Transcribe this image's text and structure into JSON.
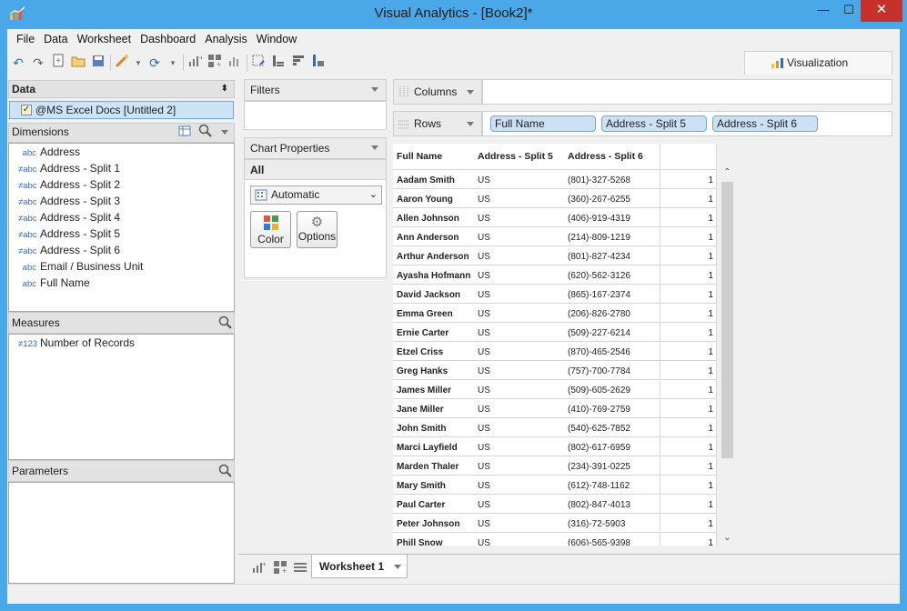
{
  "window": {
    "title": "Visual Analytics - [Book2]*",
    "min_glyph": "—",
    "max_glyph": "☐",
    "close_glyph": "✕"
  },
  "menu": [
    "File",
    "Data",
    "Worksheet",
    "Dashboard",
    "Analysis",
    "Window"
  ],
  "toolbar": {
    "icons": [
      "undo-icon",
      "redo-icon",
      "new-icon",
      "open-icon",
      "save-icon",
      "auto-update-icon",
      "refresh-icon",
      "new-worksheet-icon",
      "new-dashboard-icon",
      "show-me-icon",
      "clear-sheet-icon",
      "sort-ascending-icon",
      "sort-descending-icon",
      "fit-icon"
    ],
    "visualization_tab": "Visualization"
  },
  "data_panel": {
    "title": "Data",
    "datasource": "@MS Excel Docs [Untitled 2]",
    "dimensions_title": "Dimensions",
    "dimensions": [
      {
        "type": "abc",
        "name": "Address"
      },
      {
        "type": "≠abc",
        "name": "Address - Split 1"
      },
      {
        "type": "≠abc",
        "name": "Address - Split 2"
      },
      {
        "type": "≠abc",
        "name": "Address - Split 3"
      },
      {
        "type": "≠abc",
        "name": "Address - Split 4"
      },
      {
        "type": "≠abc",
        "name": "Address - Split 5"
      },
      {
        "type": "≠abc",
        "name": "Address - Split 6"
      },
      {
        "type": "abc",
        "name": "Email / Business Unit"
      },
      {
        "type": "abc",
        "name": "Full Name"
      }
    ],
    "measures_title": "Measures",
    "measures": [
      {
        "type": "≠123",
        "name": "Number of Records"
      }
    ],
    "parameters_title": "Parameters"
  },
  "filters": {
    "title": "Filters"
  },
  "chart_properties": {
    "title": "Chart Properties",
    "all_label": "All",
    "mark_type": "Automatic",
    "color_label": "Color",
    "options_label": "Options"
  },
  "shelves": {
    "columns_label": "Columns",
    "rows_label": "Rows",
    "rows_pills": [
      "Full Name",
      "Address - Split 5",
      "Address - Split 6"
    ]
  },
  "table": {
    "headers": [
      "Full Name",
      "Address - Split 5",
      "Address - Split 6",
      ""
    ],
    "rows": [
      [
        "Aadam Smith",
        "US",
        "(801)-327-5268",
        "1"
      ],
      [
        "Aaron Young",
        "US",
        "(360)-267-6255",
        "1"
      ],
      [
        "Allen Johnson",
        "US",
        "(406)-919-4319",
        "1"
      ],
      [
        "Ann Anderson",
        "US",
        "(214)-809-1219",
        "1"
      ],
      [
        "Arthur Anderson",
        "US",
        "(801)-827-4234",
        "1"
      ],
      [
        "Ayasha Hofmann",
        "US",
        "(620)-562-3126",
        "1"
      ],
      [
        "David Jackson",
        "US",
        "(865)-167-2374",
        "1"
      ],
      [
        "Emma Green",
        "US",
        "(206)-826-2780",
        "1"
      ],
      [
        "Ernie Carter",
        "US",
        "(509)-227-6214",
        "1"
      ],
      [
        "Etzel Criss",
        "US",
        "(870)-465-2546",
        "1"
      ],
      [
        "Greg Hanks",
        "US",
        "(757)-700-7784",
        "1"
      ],
      [
        "James Miller",
        "US",
        "(509)-605-2629",
        "1"
      ],
      [
        "Jane Miller",
        "US",
        "(410)-769-2759",
        "1"
      ],
      [
        "John Smith",
        "US",
        "(540)-625-7852",
        "1"
      ],
      [
        "Marci Layfield",
        "US",
        "(802)-617-6959",
        "1"
      ],
      [
        "Marden Thaler",
        "US",
        "(234)-391-0225",
        "1"
      ],
      [
        "Mary Smith",
        "US",
        "(612)-748-1162",
        "1"
      ],
      [
        "Paul Carter",
        "US",
        "(802)-847-4013",
        "1"
      ],
      [
        "Peter Johnson",
        "US",
        "(316)-72-5903",
        "1"
      ],
      [
        "Phill Snow",
        "US",
        "(606)-565-9398",
        "1"
      ]
    ]
  },
  "sheet_tabs": [
    "Worksheet 1"
  ],
  "colors": {
    "title_bar": "#4aa8e8",
    "close": "#c7312b",
    "pill": "#cde1f6"
  }
}
